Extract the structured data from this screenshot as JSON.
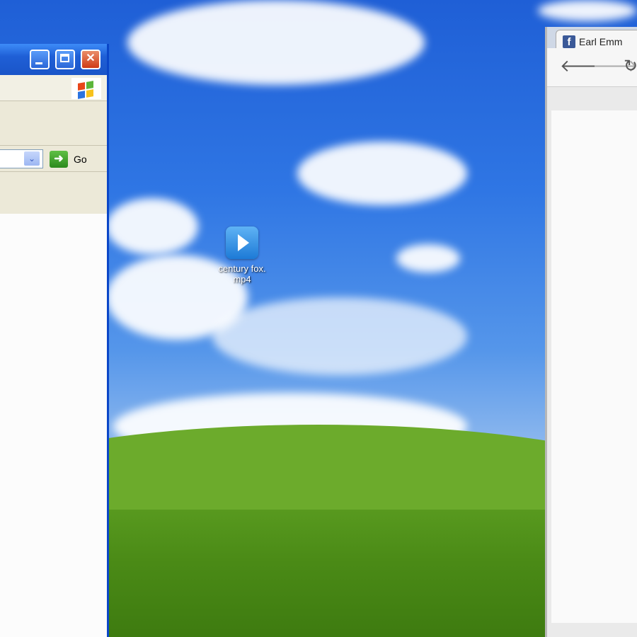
{
  "desktop": {
    "icon": {
      "name": "video-file-icon",
      "label": "century fox.mp4"
    }
  },
  "left_window": {
    "go_label": "Go"
  },
  "browser": {
    "tab_title": "Earl Emm",
    "favicon_letter": "f"
  },
  "colors": {
    "xp_blue": "#1f5fd6",
    "xp_close_red": "#cf3b15",
    "facebook_blue": "#3b5998"
  }
}
